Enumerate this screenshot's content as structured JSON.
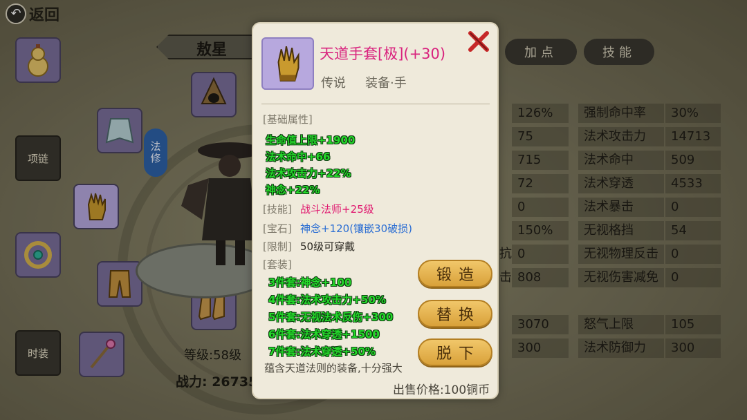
{
  "header": {
    "back_label": "返回"
  },
  "character": {
    "name": "敖星",
    "sect": "法修",
    "level": "等级:58级",
    "power": "战力: 26735"
  },
  "side_buttons": {
    "necklace": "项链",
    "fashion": "时装"
  },
  "tabs": {
    "add_points": "加点",
    "skills": "技能"
  },
  "stats": {
    "col1": [
      "126%",
      "75",
      "715",
      "72",
      "0",
      "150%",
      "0",
      "808",
      "3070",
      "300"
    ],
    "col1_partial_labels": {
      "row7": "抗",
      "row8": "击"
    },
    "col2": [
      {
        "label": "强制命中率",
        "value": "30%"
      },
      {
        "label": "法术攻击力",
        "value": "14713"
      },
      {
        "label": "法术命中",
        "value": "509"
      },
      {
        "label": "法术穿透",
        "value": "4533"
      },
      {
        "label": "法术暴击",
        "value": "0"
      },
      {
        "label": "无视格挡",
        "value": "54"
      },
      {
        "label": "无视物理反击",
        "value": "0"
      },
      {
        "label": "无视伤害减免",
        "value": "0"
      },
      {
        "label": "怒气上限",
        "value": "105"
      },
      {
        "label": "法术防御力",
        "value": "300"
      }
    ]
  },
  "popup": {
    "item_name": "天道手套[极](+30)",
    "rarity": "传说",
    "slot": "装备·手",
    "basic_header": "[基础属性]",
    "basic_attrs": [
      "生命值上限+1900",
      "法术命中+66",
      "法术攻击力+22%",
      "神念+22%"
    ],
    "skill_label": "[技能]",
    "skill_value": "战斗法师+25级",
    "gem_label": "[宝石]",
    "gem_value": "神念+120(镶嵌30破损)",
    "limit_label": "[限制]",
    "limit_value": "50级可穿戴",
    "set_header": "[套装]",
    "set_attrs": [
      "3件套:神念+100",
      "4件套:法术攻击力+50%",
      "5件套:无视法术反伤+300",
      "6件套:法术穿透+1500",
      "7件套:法术穿透+50%"
    ],
    "description": "蕴含天道法则的装备,十分强大",
    "price": "出售价格:100铜币",
    "buttons": {
      "forge": "锻造",
      "replace": "替换",
      "unequip": "脱下"
    }
  }
}
